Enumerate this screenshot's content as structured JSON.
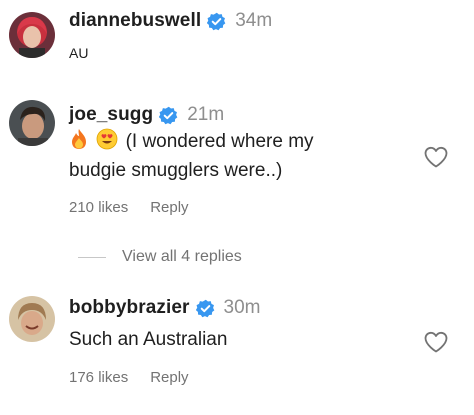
{
  "comments": [
    {
      "username": "diannebuswell",
      "time": "34m",
      "text": "AU",
      "avatar": "avatar-red-hair"
    },
    {
      "username": "joe_sugg",
      "time": "21m",
      "emojis": [
        "fire-emoji",
        "heart-eyes-emoji"
      ],
      "text_line1": "(I wondered where my",
      "text_line2": "budgie smugglers were..)",
      "likes": "210 likes",
      "reply": "Reply",
      "avatar": "avatar-dark-hair"
    },
    {
      "username": "bobbybrazier",
      "time": "30m",
      "text": "Such an Australian",
      "likes": "176 likes",
      "reply": "Reply",
      "avatar": "avatar-light-hair"
    }
  ],
  "view_replies": "View all 4 replies",
  "colors": {
    "verified": "#3897f0",
    "muted": "#737373",
    "time": "#8e8e8e"
  }
}
